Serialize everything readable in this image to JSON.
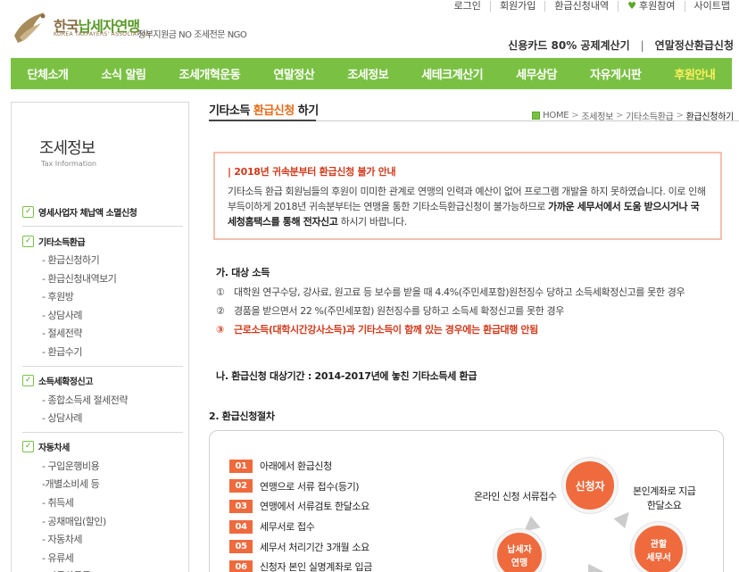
{
  "top_links": [
    {
      "label": "로그인"
    },
    {
      "label": "회원가입"
    },
    {
      "label": "환급신청내역"
    },
    {
      "label": "후원참여",
      "heart": true
    },
    {
      "label": "사이트맵"
    }
  ],
  "logo": {
    "name_part1": "한국",
    "name_part2": "납세자연맹",
    "english": "KOREA TAXPAYERS' ASSOCIATION",
    "tagline": "정부지원금 NO 조세전문 NGO"
  },
  "promo": {
    "link1": "신용카드 80% 공제계산기",
    "separator": "|",
    "link2": "연말정산환급신청"
  },
  "nav": [
    {
      "label": "단체소개"
    },
    {
      "label": "소식 알림"
    },
    {
      "label": "조세개혁운동"
    },
    {
      "label": "연말정산"
    },
    {
      "label": "조세정보"
    },
    {
      "label": "세테크계산기"
    },
    {
      "label": "세무상담"
    },
    {
      "label": "자유게시판"
    },
    {
      "label": "후원안내",
      "active": true
    }
  ],
  "sidebar": {
    "title": "조세정보",
    "subtitle": "Tax Information",
    "categories": [
      {
        "label": "영세사업자 체납액 소멸신청",
        "items": []
      },
      {
        "label": "기타소득환급",
        "items": [
          "- 환급신청하기",
          "- 환급신청내역보기",
          "- 후원방",
          "- 상담사례",
          "- 절세전략",
          "- 환급수기"
        ]
      },
      {
        "label": "소득세확정신고",
        "items": [
          "- 종합소득세 절세전략",
          "- 상담사례"
        ]
      },
      {
        "label": "자동차세",
        "items": [
          "- 구입운행비용",
          "-개별소비세 등",
          "- 취득세",
          "- 공채매입(할인)",
          "- 자동차세",
          "- 유류세",
          "- 자동차등록"
        ]
      }
    ]
  },
  "page": {
    "title_prefix": "기타소득 ",
    "title_highlight": "환급신청",
    "title_suffix": " 하기",
    "breadcrumb": [
      "HOME",
      "조세정보",
      "기타소득환급",
      "환급신청하기"
    ],
    "breadcrumb_sep": ">"
  },
  "notice": {
    "title": "| 2018년 귀속분부터 환급신청 불가 안내",
    "body_plain": "기타소득 환급 회원님들의 후원이 미미한 관계로 연맹의 인력과 예산이 없어 프로그램 개발을 하지 못하였습니다. 이로 인해 부득이하게 2018년 귀속분부터는 연맹을 통한 기타소득환급신청이 불가능하므로 ",
    "body_bold": "가까운 세무서에서 도움 받으시거나 국세청홈택스를 통해 전자신고",
    "body_end": " 하시기 바랍니다."
  },
  "section_a": {
    "heading": "가. 대상 소득",
    "items": [
      {
        "num": "①",
        "text": "대학원 연구수당, 강사료, 원고료 등 보수를 받을 때 4.4%(주민세포함)원천징수 당하고 소득세확정신고를 못한 경우",
        "red": false
      },
      {
        "num": "②",
        "text": "경품을 받으면서 22 %(주민세포함) 원천징수를 당하고 소득세 확정신고를 못한 경우",
        "red": false
      },
      {
        "num": "③",
        "text": "근로소득(대학시간강사소득)과 기타소득이 함께 있는 경우에는 환급대행 안됨",
        "red": true
      }
    ]
  },
  "section_b": {
    "heading": "나. 환급신청 대상기간 : 2014-2017년에 놓친 기타소득세 환급"
  },
  "section_2": {
    "heading": "2. 환급신청절차",
    "steps": [
      {
        "badge": "01",
        "text": "아래에서 환급신청"
      },
      {
        "badge": "02",
        "text": "연맹으로 서류 접수(등기)"
      },
      {
        "badge": "03",
        "text": "연맹에서 서류검토 한달소요"
      },
      {
        "badge": "04",
        "text": "세무서로 접수"
      },
      {
        "badge": "05",
        "text": "세무서 처리기간 3개월 소요"
      },
      {
        "badge": "06",
        "text": "신청자 본인 실명계좌로 입금"
      }
    ],
    "diagram": {
      "applicant": "신청자",
      "taxpayer_line1": "납세자",
      "taxpayer_line2": "연맹",
      "office_line1": "관할",
      "office_line2": "세무서",
      "label_online": "온라인 신청 서류접수",
      "label_refund_line1": "본인계좌로 지급",
      "label_refund_line2": "한달소요"
    }
  },
  "colors": {
    "nav_green": "#7ac143",
    "accent_orange": "#ef6a3d",
    "notice_red": "#d13a1c",
    "nav_active": "#ffef5a"
  }
}
